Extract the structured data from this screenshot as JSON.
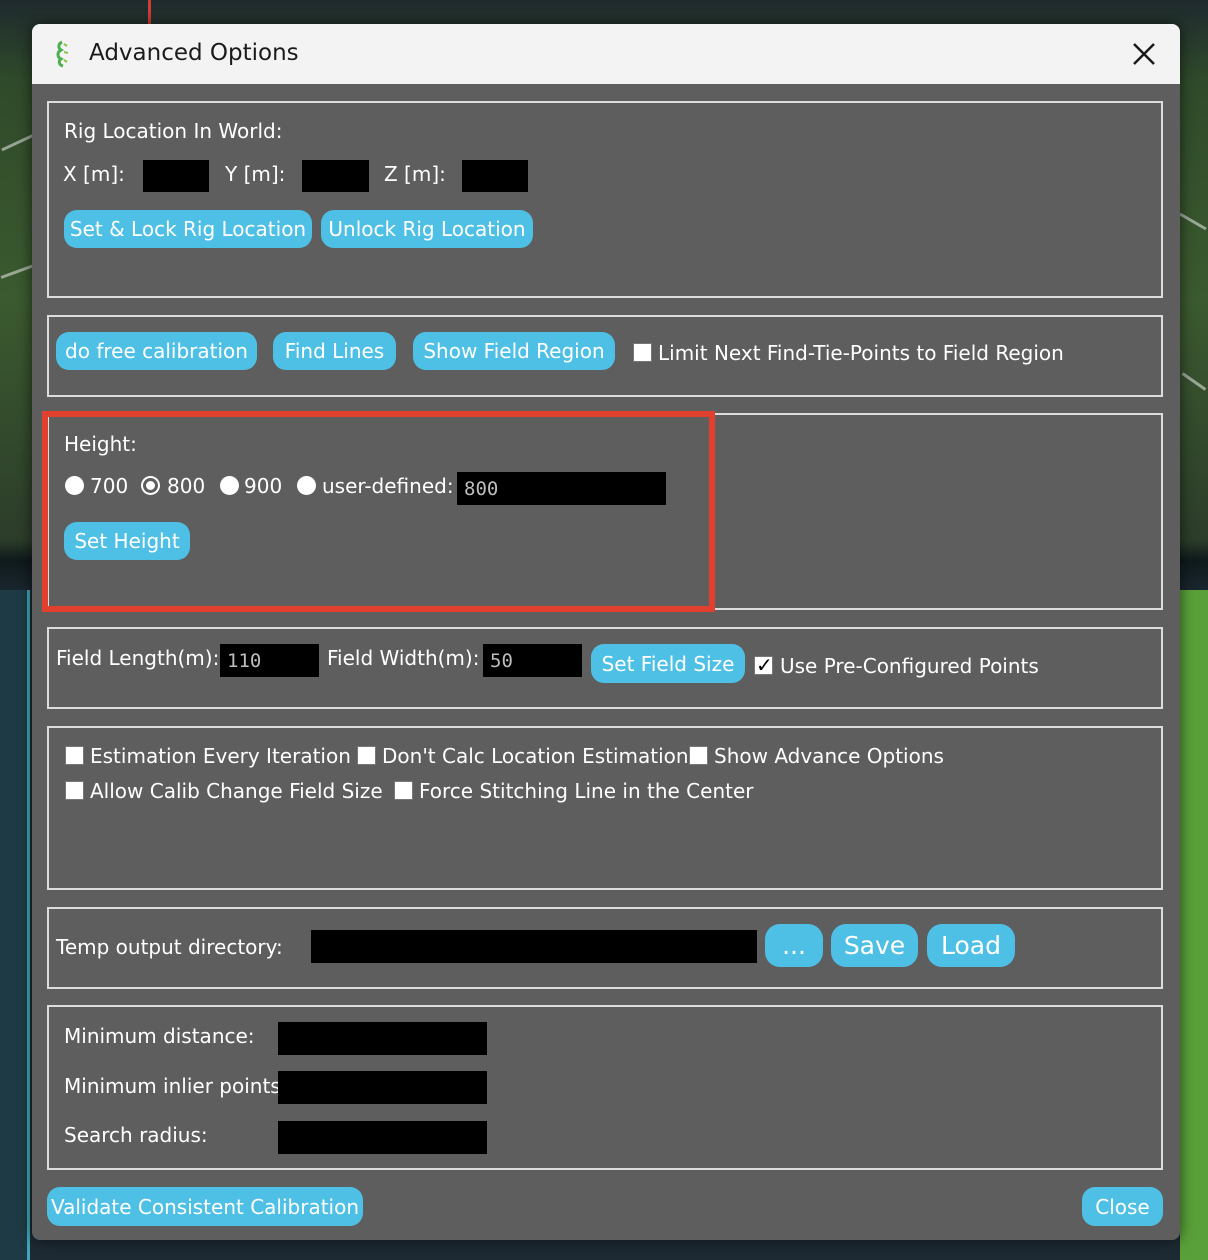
{
  "dialog": {
    "title": "Advanced Options",
    "close_icon": "close-icon",
    "app_icon": "app-logo-icon"
  },
  "rig": {
    "heading": "Rig Location In World:",
    "x_label": "X [m]:",
    "y_label": "Y [m]:",
    "z_label": "Z [m]:",
    "x_value": "",
    "y_value": "",
    "z_value": "",
    "set_lock_label": "Set & Lock Rig Location",
    "unlock_label": "Unlock Rig Location"
  },
  "calib": {
    "free_calib_label": "do free calibration",
    "find_lines_label": "Find Lines",
    "show_field_region_label": "Show Field Region",
    "limit_label": "Limit Next Find-Tie-Points to Field Region",
    "limit_checked": false
  },
  "height": {
    "heading": "Height:",
    "options": [
      "700",
      "800",
      "900",
      "user-defined:"
    ],
    "selected": "800",
    "user_value": "800",
    "set_label": "Set Height"
  },
  "field_size": {
    "length_label": "Field Length(m):",
    "length_value": "110",
    "width_label": "Field Width(m):",
    "width_value": "50",
    "set_label": "Set Field Size",
    "preconfig_label": "Use Pre-Configured Points",
    "preconfig_checked": true
  },
  "options": {
    "estimation_every_iteration": "Estimation Every Iteration",
    "dont_calc_location": "Don't Calc Location Estimation",
    "show_advance_options": "Show Advance Options",
    "allow_calib_change": "Allow Calib Change Field Size",
    "force_stitching": "Force Stitching Line in the Center"
  },
  "output": {
    "label": "Temp output directory:",
    "value": "",
    "browse_label": "...",
    "save_label": "Save",
    "load_label": "Load"
  },
  "params": {
    "min_distance_label": "Minimum distance:",
    "min_inlier_label": "Minimum inlier points:",
    "search_radius_label": "Search radius:",
    "min_distance_value": "",
    "min_inlier_value": "",
    "search_radius_value": ""
  },
  "footer": {
    "validate_label": "Validate Consistent Calibration",
    "close_label": "Close"
  },
  "colors": {
    "dialog_bg": "#5e5e5e",
    "button_bg": "#4fc0e5",
    "highlight": "#e2402f",
    "field_bg": "#000000"
  }
}
